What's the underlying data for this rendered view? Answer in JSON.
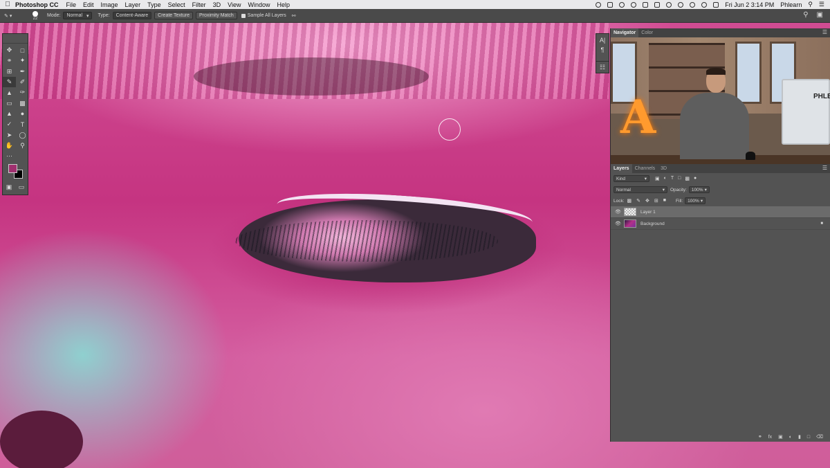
{
  "menubar": {
    "app_name": "Photoshop CC",
    "menus": [
      "File",
      "Edit",
      "Image",
      "Layer",
      "Type",
      "Select",
      "Filter",
      "3D",
      "View",
      "Window",
      "Help"
    ],
    "clock": "Fri Jun 2  3:14 PM",
    "user": "Phlearn"
  },
  "options": {
    "brush_size": "22",
    "mode_label": "Mode:",
    "mode_value": "Normal",
    "type_label": "Type:",
    "type_buttons": [
      "Content-Aware",
      "Create Texture",
      "Proximity Match"
    ],
    "sample_all_layers": "Sample All Layers"
  },
  "tools": {
    "foreground_color": "#a0306f",
    "background_color": "#000000"
  },
  "navigator": {
    "tabs": [
      "Navigator",
      "Color"
    ],
    "preview_sign": "PHLEARN"
  },
  "layers": {
    "tabs": [
      "Layers",
      "Channels",
      "3D"
    ],
    "filter_kind": "Kind",
    "blend_mode": "Normal",
    "opacity_label": "Opacity:",
    "opacity_value": "100%",
    "lock_label": "Lock:",
    "fill_label": "Fill:",
    "fill_value": "100%",
    "items": [
      {
        "name": "Layer 1",
        "selected": true
      },
      {
        "name": "Background",
        "selected": false,
        "locked": true
      }
    ]
  }
}
